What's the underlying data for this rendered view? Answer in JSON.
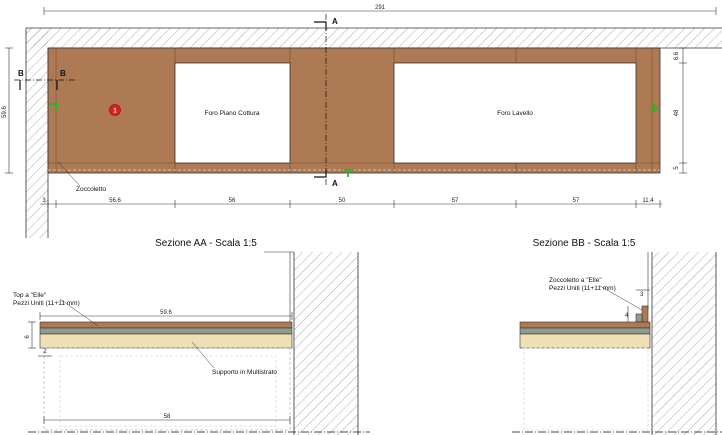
{
  "plan": {
    "overall_width": "291",
    "height_left": "59.6",
    "right_dims": [
      "6.6",
      "48",
      "5"
    ],
    "bottom_dims": [
      "3",
      "56.6",
      "56",
      "50",
      "57",
      "57",
      "11.4"
    ],
    "hole_cooktop": "Foro Piano Cottura",
    "hole_sink": "Foro Lavello",
    "plinth_label": "Zoccoletto",
    "badge": "1",
    "section_a": "A",
    "section_b": "B"
  },
  "section_aa": {
    "title": "Sezione AA - Scala 1:5",
    "top_label_1": "Top a \"Elle\"",
    "top_label_2": "Pezzi Uniti (11+11 mm)",
    "dim_top": "59.6",
    "dim_thickness": "6",
    "dim_edge": "2",
    "support_label": "Supporto in Multistrato",
    "dim_bottom": "58"
  },
  "section_bb": {
    "title": "Sezione BB - Scala 1:5",
    "label_1": "Zoccoletto a \"Elle\"",
    "label_2": "Pezzi Uniti (11+11 mm)",
    "dim_3": "3",
    "dim_4": "4"
  },
  "colors": {
    "wood": "#ae7a54",
    "support": "#eedfb4",
    "accent_green": "#22bb22",
    "badge_red": "#dd2222"
  }
}
